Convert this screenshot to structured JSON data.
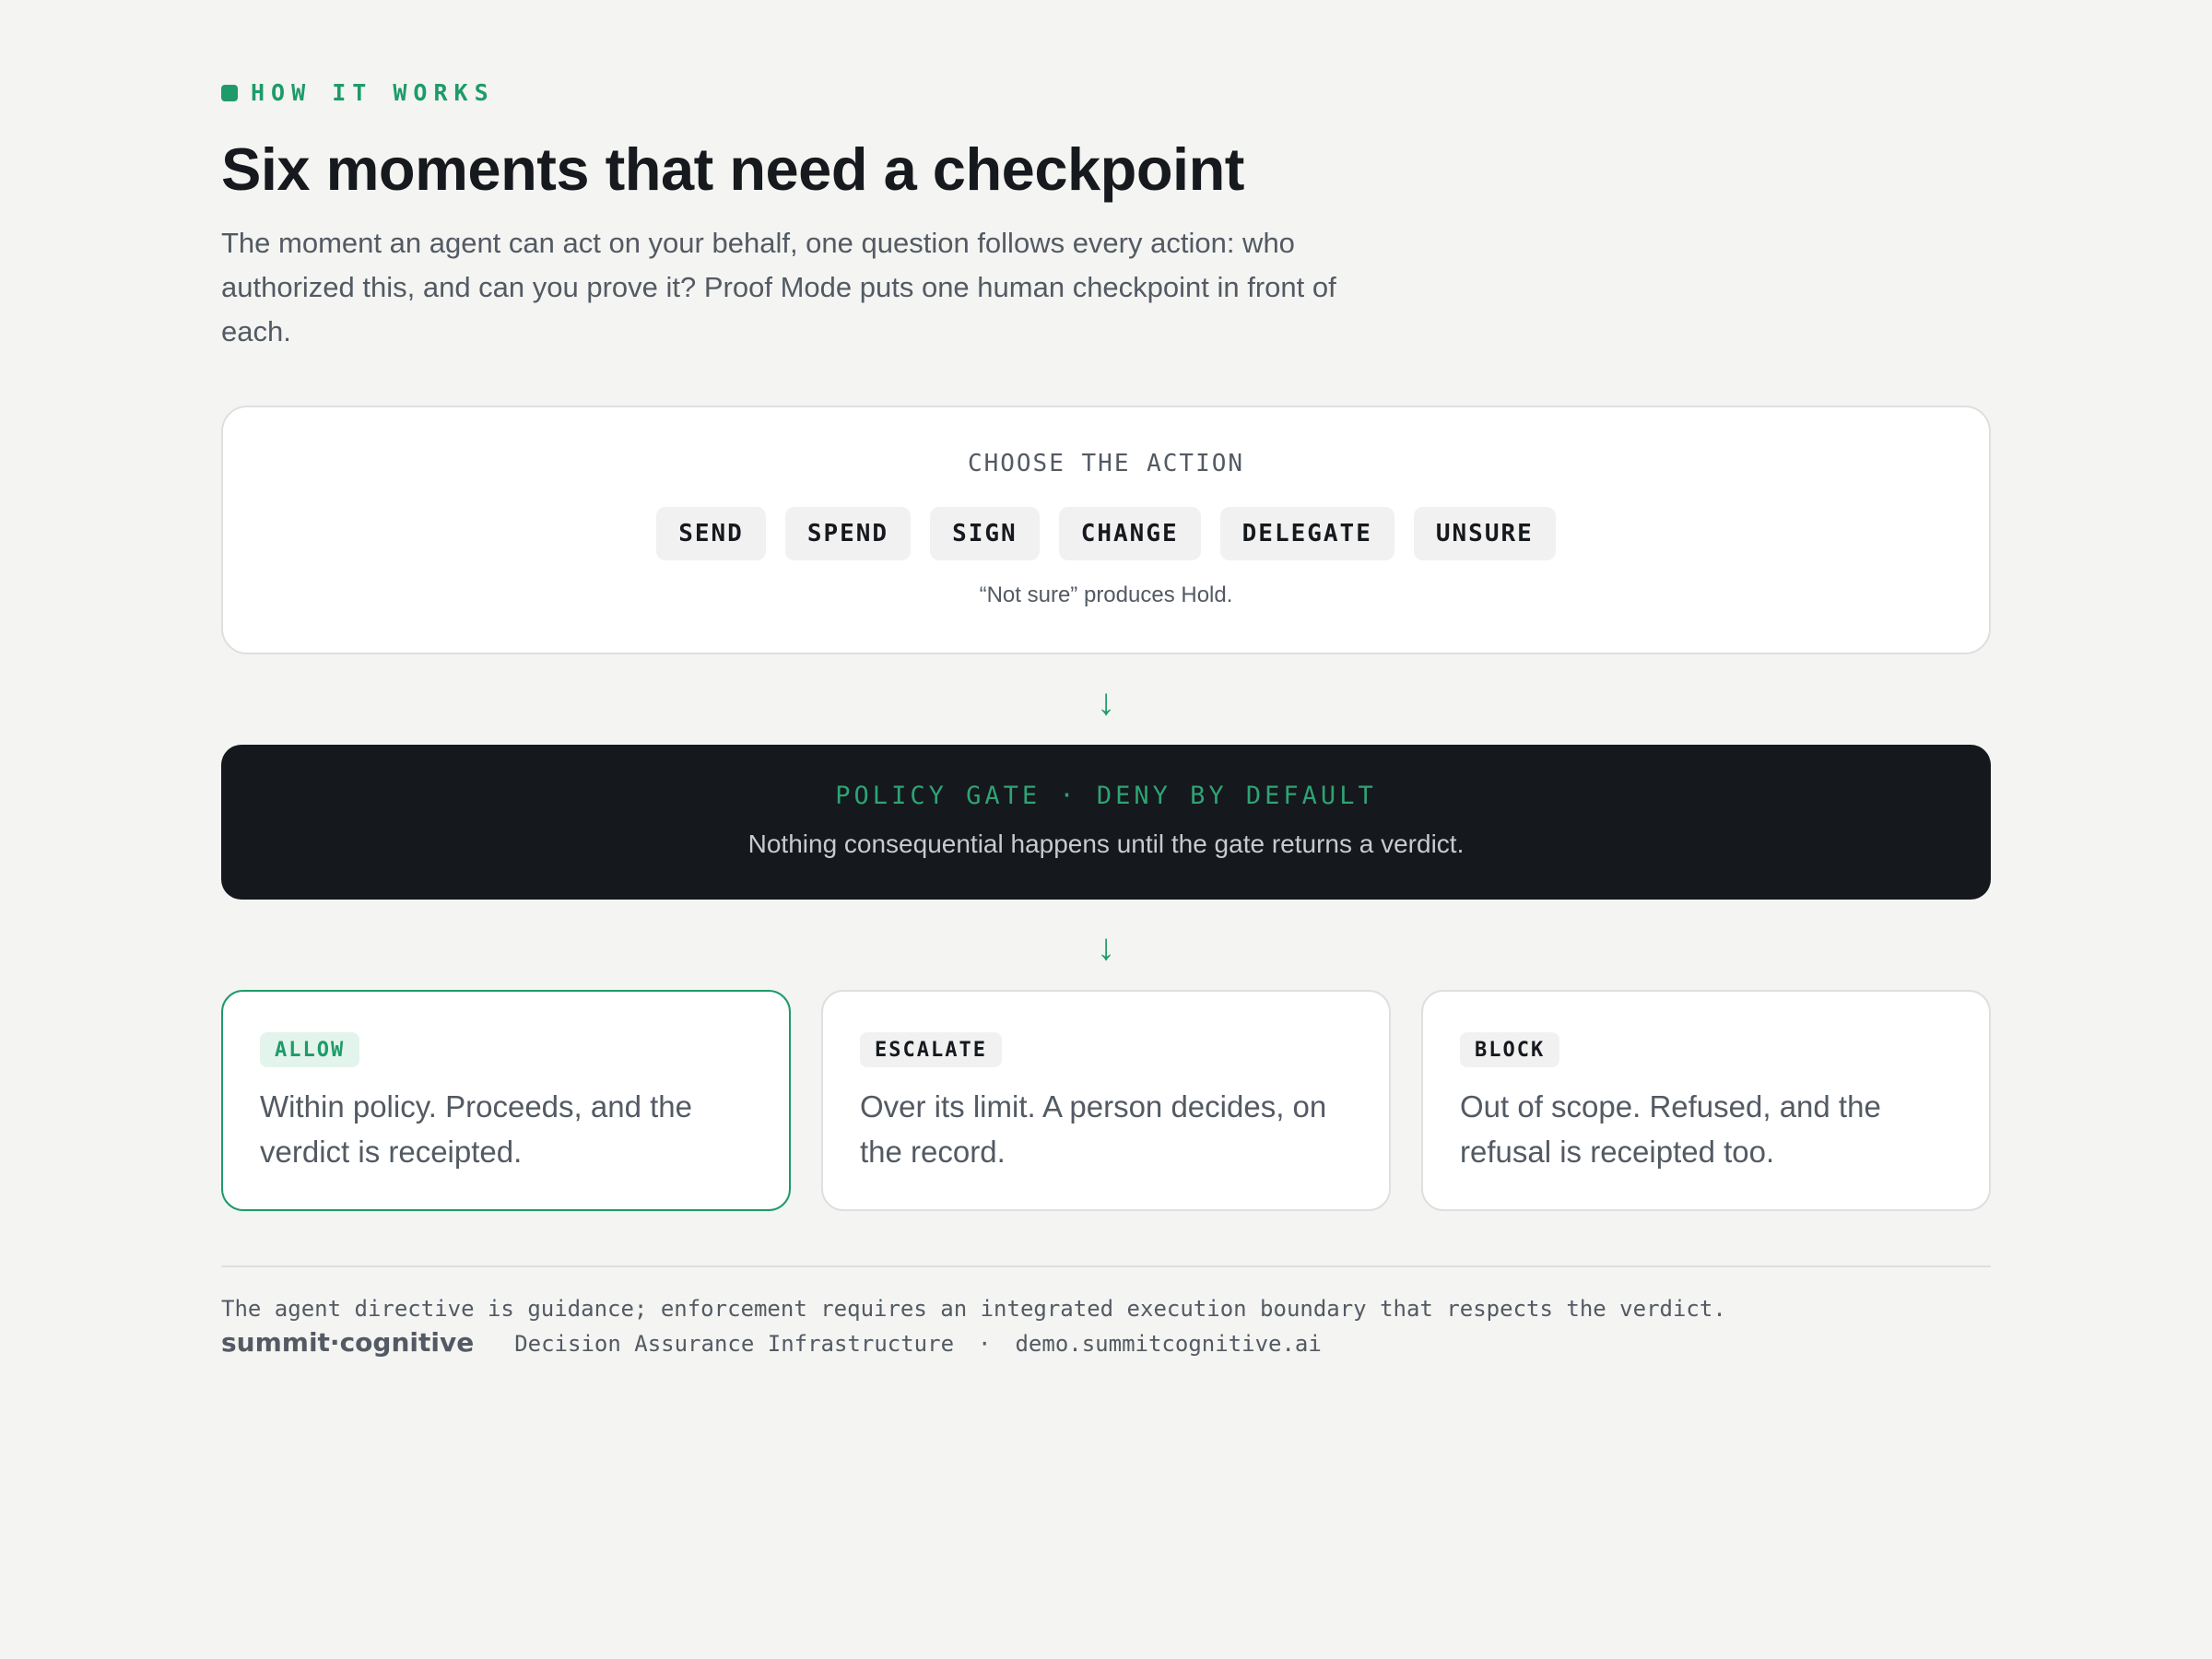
{
  "header": {
    "eyebrow": "HOW IT WORKS",
    "title": "Six moments that need a checkpoint",
    "intro": "The moment an agent can act on your behalf, one question follows every action: who authorized this, and can you prove it? Proof Mode puts one human checkpoint in front of each."
  },
  "action_picker": {
    "heading": "CHOOSE THE ACTION",
    "actions": [
      "SEND",
      "SPEND",
      "SIGN",
      "CHANGE",
      "DELEGATE",
      "UNSURE"
    ],
    "note": "“Not sure” produces Hold."
  },
  "arrow_glyph": "↓",
  "gate": {
    "title": "POLICY GATE · DENY BY DEFAULT",
    "subtitle": "Nothing consequential happens until the gate returns a verdict."
  },
  "verdicts": [
    {
      "badge": "ALLOW",
      "text": "Within policy. Proceeds, and the verdict is receipted."
    },
    {
      "badge": "ESCALATE",
      "text": "Over its limit. A person decides, on the record."
    },
    {
      "badge": "BLOCK",
      "text": "Out of scope. Refused, and the refusal is receipted too."
    }
  ],
  "footer": {
    "note": "The agent directive is guidance; enforcement requires an integrated execution boundary that respects the verdict.",
    "brand": "summit·cognitive",
    "tagline": "Decision Assurance Infrastructure",
    "separator": "·",
    "domain": "demo.summitcognitive.ai"
  },
  "colors": {
    "accent": "#1e9b69",
    "background": "#f4f4f2",
    "gate_background": "#15181c",
    "text": "#16191d",
    "muted_text": "#535a63"
  }
}
